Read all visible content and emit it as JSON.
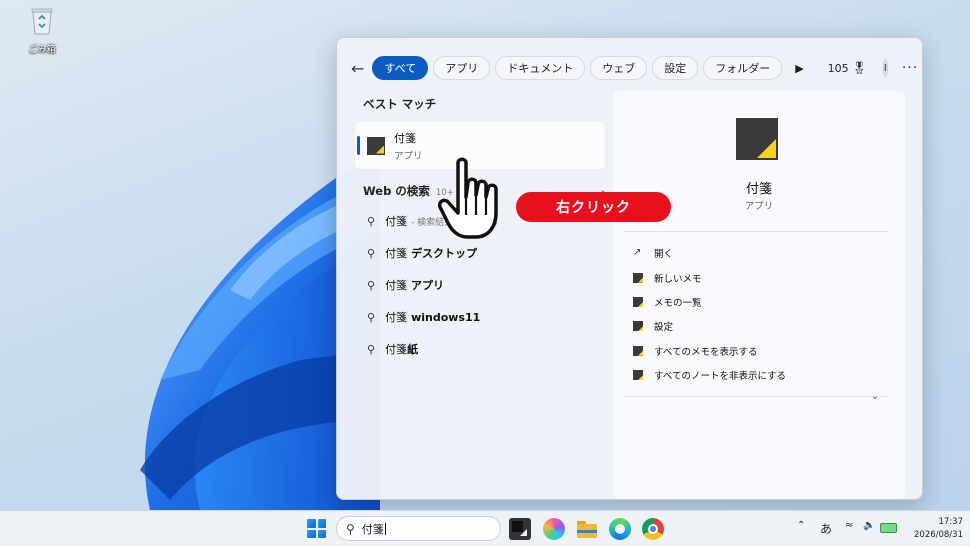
{
  "desktop": {
    "recycle_bin_label": "ごみ箱"
  },
  "search_panel": {
    "filters": [
      {
        "label": "すべて",
        "active": true
      },
      {
        "label": "アプリ",
        "active": false
      },
      {
        "label": "ドキュメント",
        "active": false
      },
      {
        "label": "ウェブ",
        "active": false
      },
      {
        "label": "設定",
        "active": false
      },
      {
        "label": "フォルダー",
        "active": false
      }
    ],
    "points": "105",
    "avatar_letter": "I",
    "best_match_heading": "ベスト マッチ",
    "best_match": {
      "title": "付箋",
      "subtitle": "アプリ"
    },
    "web_heading": "Web の検索",
    "web_count": "10+",
    "web_results": [
      {
        "term": "付箋",
        "extra": "",
        "hint": "- 検索結果を表示する"
      },
      {
        "term": "付箋",
        "extra": "デスクトップ",
        "hint": ""
      },
      {
        "term": "付箋",
        "extra": "アプリ",
        "hint": ""
      },
      {
        "term": "付箋",
        "extra": "windows11",
        "hint": ""
      },
      {
        "term": "付箋",
        "extra": "紙",
        "hint": ""
      }
    ],
    "detail": {
      "name": "付箋",
      "type": "アプリ",
      "actions": [
        {
          "label": "開く",
          "icon": "open-icon"
        },
        {
          "label": "新しいメモ",
          "icon": "sticky-notes-icon"
        },
        {
          "label": "メモの一覧",
          "icon": "sticky-notes-icon"
        },
        {
          "label": "設定",
          "icon": "sticky-notes-icon"
        },
        {
          "label": "すべてのメモを表示する",
          "icon": "sticky-notes-icon"
        },
        {
          "label": "すべてのノートを非表示にする",
          "icon": "sticky-notes-icon"
        }
      ]
    }
  },
  "callout": {
    "text": "右クリック"
  },
  "taskbar": {
    "search_value": "付箋",
    "ime_indicator": "あ",
    "time": "17:37",
    "date": "2026/08/31"
  },
  "colors": {
    "accent": "#0a5cc2",
    "callout": "#e8101c",
    "sticky_yellow": "#f6d21b"
  }
}
